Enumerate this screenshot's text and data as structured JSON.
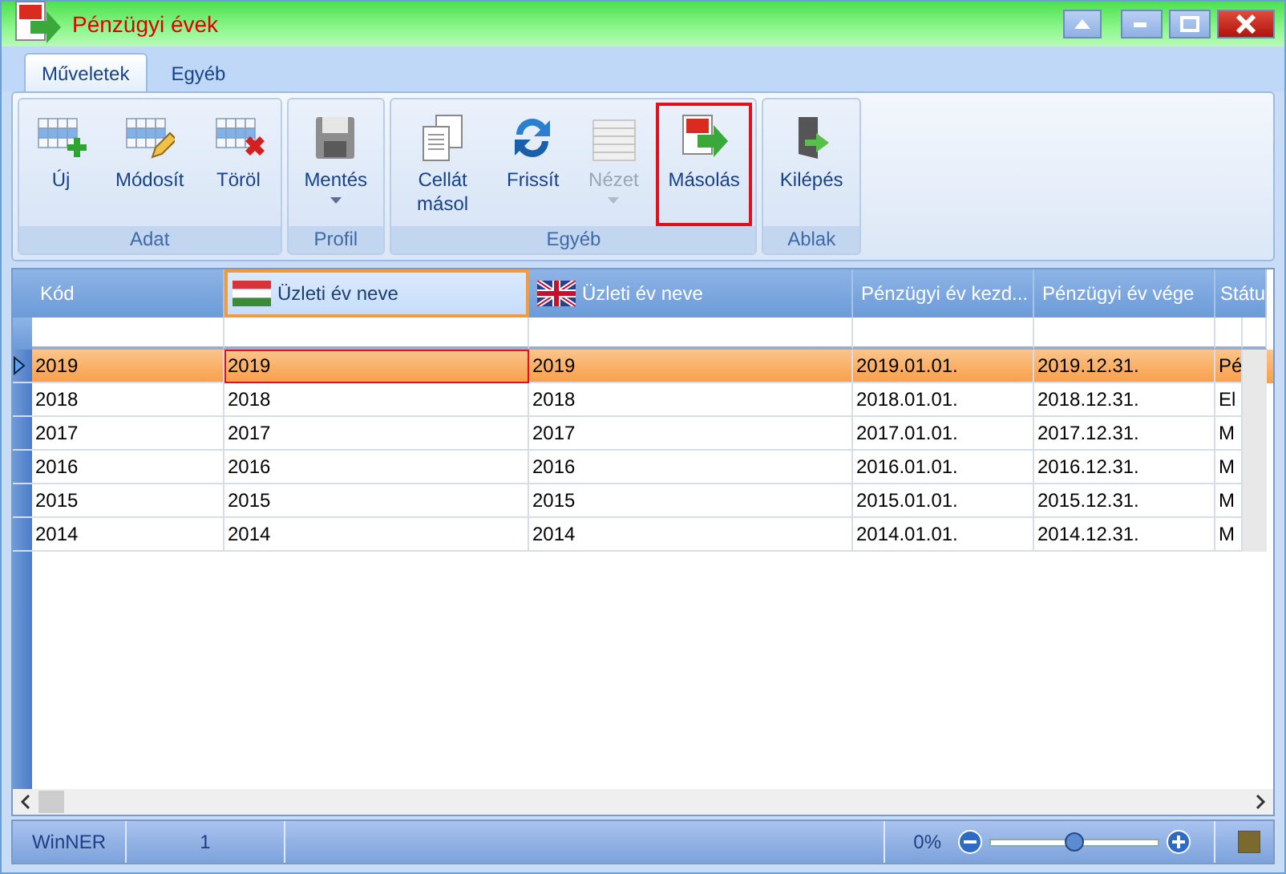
{
  "window": {
    "title": "Pénzügyi évek"
  },
  "tabs": [
    {
      "label": "Műveletek",
      "selected": true
    },
    {
      "label": "Egyéb",
      "selected": false
    }
  ],
  "ribbon": [
    {
      "name": "Adat",
      "buttons": [
        {
          "label": "Új",
          "kind": "add",
          "disabled": false,
          "highlighted": false,
          "dropdown": false
        },
        {
          "label": "Módosít",
          "kind": "edit",
          "disabled": false,
          "highlighted": false,
          "dropdown": false
        },
        {
          "label": "Töröl",
          "kind": "delete",
          "disabled": false,
          "highlighted": false,
          "dropdown": false
        }
      ]
    },
    {
      "name": "Profil",
      "buttons": [
        {
          "label": "Mentés",
          "kind": "save",
          "disabled": false,
          "highlighted": false,
          "dropdown": true
        }
      ]
    },
    {
      "name": "Egyéb",
      "buttons": [
        {
          "label": "Cellát másol",
          "kind": "copy",
          "disabled": false,
          "highlighted": false,
          "dropdown": false
        },
        {
          "label": "Frissít",
          "kind": "refresh",
          "disabled": false,
          "highlighted": false,
          "dropdown": false
        },
        {
          "label": "Nézet",
          "kind": "view",
          "disabled": true,
          "highlighted": false,
          "dropdown": true
        },
        {
          "label": "Másolás",
          "kind": "duplicate",
          "disabled": false,
          "highlighted": true,
          "dropdown": false
        }
      ]
    },
    {
      "name": "Ablak",
      "buttons": [
        {
          "label": "Kilépés",
          "kind": "exit",
          "disabled": false,
          "highlighted": false,
          "dropdown": false
        }
      ]
    }
  ],
  "table": {
    "columns": [
      {
        "label": "Kód",
        "kind": "plain",
        "focused": false
      },
      {
        "label": "Üzleti év neve",
        "kind": "hungarian",
        "focused": true
      },
      {
        "label": "Üzleti év neve",
        "kind": "english",
        "focused": false
      },
      {
        "label": "Pénzügyi év kezd...",
        "kind": "plain",
        "focused": false
      },
      {
        "label": "Pénzügyi év vége",
        "kind": "plain",
        "focused": false
      },
      {
        "label": "Státu",
        "kind": "plain",
        "focused": false
      }
    ],
    "rows": [
      {
        "cells": [
          "2019",
          "2019",
          "2019",
          "2019.01.01.",
          "2019.12.31.",
          "Pé"
        ],
        "selected": true
      },
      {
        "cells": [
          "2018",
          "2018",
          "2018",
          "2018.01.01.",
          "2018.12.31.",
          "El"
        ],
        "selected": false
      },
      {
        "cells": [
          "2017",
          "2017",
          "2017",
          "2017.01.01.",
          "2017.12.31.",
          "M"
        ],
        "selected": false
      },
      {
        "cells": [
          "2016",
          "2016",
          "2016",
          "2016.01.01.",
          "2016.12.31.",
          "M"
        ],
        "selected": false
      },
      {
        "cells": [
          "2015",
          "2015",
          "2015",
          "2015.01.01.",
          "2015.12.31.",
          "M"
        ],
        "selected": false
      },
      {
        "cells": [
          "2014",
          "2014",
          "2014",
          "2014.01.01.",
          "2014.12.31.",
          "M"
        ],
        "selected": false
      }
    ]
  },
  "status_bar": {
    "app": "WinNER",
    "count": "1",
    "zoom_reading": "0%",
    "zoom": {
      "level": 0.5
    }
  }
}
